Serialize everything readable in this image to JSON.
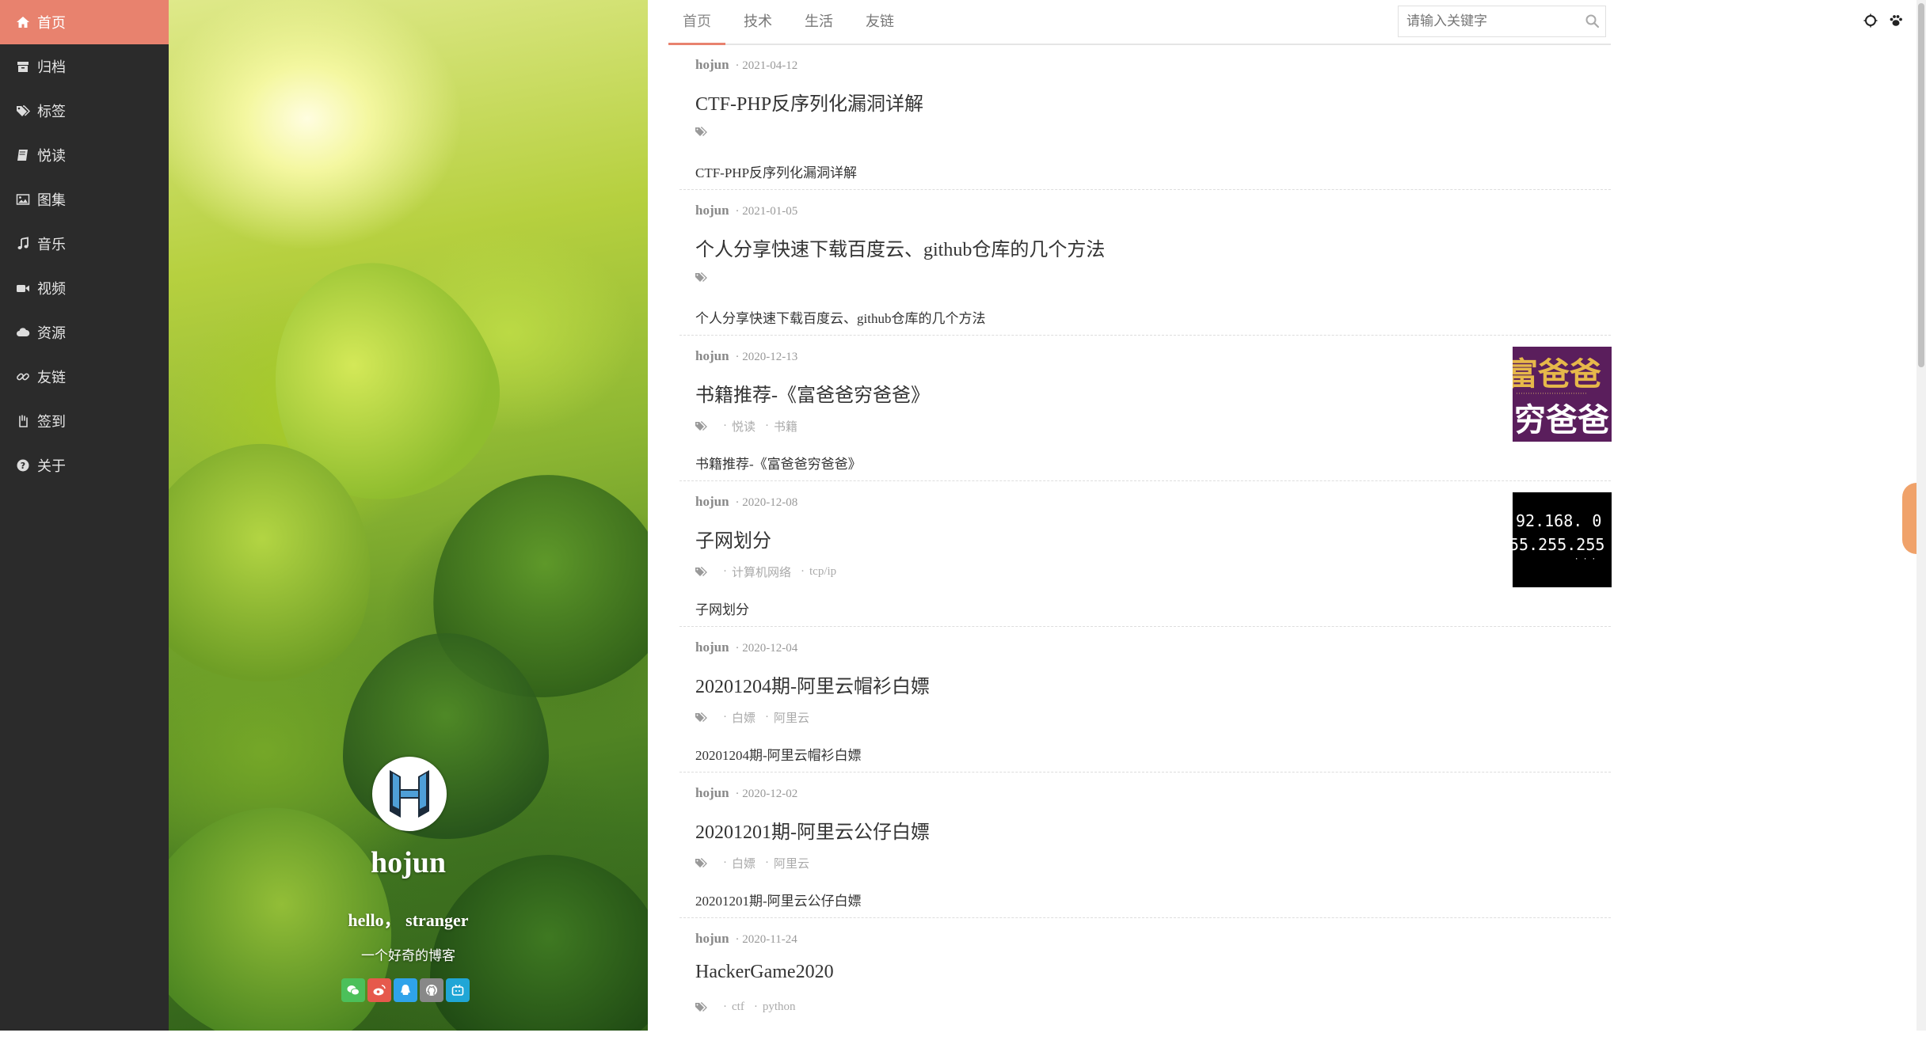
{
  "sidebar": {
    "items": [
      {
        "label": "首页",
        "icon": "home-icon"
      },
      {
        "label": "归档",
        "icon": "archive-icon"
      },
      {
        "label": "标签",
        "icon": "tags-icon"
      },
      {
        "label": "悦读",
        "icon": "book-icon"
      },
      {
        "label": "图集",
        "icon": "image-icon"
      },
      {
        "label": "音乐",
        "icon": "music-icon"
      },
      {
        "label": "视频",
        "icon": "video-icon"
      },
      {
        "label": "资源",
        "icon": "cloud-icon"
      },
      {
        "label": "友链",
        "icon": "link-icon"
      },
      {
        "label": "签到",
        "icon": "hand-icon"
      },
      {
        "label": "关于",
        "icon": "question-icon"
      }
    ],
    "active_index": 0
  },
  "profile": {
    "name": "hojun",
    "greeting": "hello， stranger",
    "description": "一个好奇的博客",
    "socials": [
      "wechat-icon",
      "weibo-icon",
      "qq-icon",
      "github-icon",
      "bilibili-icon"
    ]
  },
  "topbar": {
    "tabs": [
      "首页",
      "技术",
      "生活",
      "友链"
    ],
    "active_tab": 0,
    "search_placeholder": "请输入关键字"
  },
  "posts": [
    {
      "author": "hojun",
      "date": "· 2021-04-12",
      "title": "CTF-PHP反序列化漏洞详解",
      "tags": [],
      "summary": "CTF-PHP反序列化漏洞详解"
    },
    {
      "author": "hojun",
      "date": "· 2021-01-05",
      "title": "个人分享快速下载百度云、github仓库的几个方法",
      "tags": [],
      "summary": "个人分享快速下载百度云、github仓库的几个方法"
    },
    {
      "author": "hojun",
      "date": "· 2020-12-13",
      "title": "书籍推荐-《富爸爸穷爸爸》",
      "tags": [
        "悦读",
        "书籍"
      ],
      "summary": "书籍推荐-《富爸爸穷爸爸》",
      "thumb_text": [
        "富爸爸",
        "穷爸爸"
      ]
    },
    {
      "author": "hojun",
      "date": "· 2020-12-08",
      "title": "子网划分",
      "tags": [
        "计算机网络",
        "tcp/ip"
      ],
      "summary": "子网划分",
      "thumb_text": [
        "92.168. 0",
        "55.255.255"
      ]
    },
    {
      "author": "hojun",
      "date": "· 2020-12-04",
      "title": "20201204期-阿里云帽衫白嫖",
      "tags": [
        "白嫖",
        "阿里云"
      ],
      "summary": "20201204期-阿里云帽衫白嫖"
    },
    {
      "author": "hojun",
      "date": "· 2020-12-02",
      "title": "20201201期-阿里云公仔白嫖",
      "tags": [
        "白嫖",
        "阿里云"
      ],
      "summary": "20201201期-阿里云公仔白嫖"
    },
    {
      "author": "hojun",
      "date": "· 2020-11-24",
      "title": "HackerGame2020",
      "tags": [
        "ctf",
        "python"
      ],
      "summary": ""
    }
  ],
  "colors": {
    "accent": "#e8826e",
    "sidebar_bg": "#2b2b2b"
  }
}
